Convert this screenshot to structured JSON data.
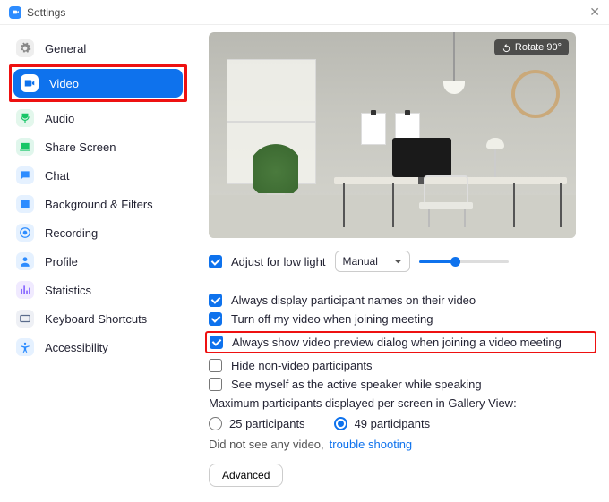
{
  "window": {
    "title": "Settings"
  },
  "sidebar": {
    "items": [
      {
        "label": "General",
        "icon": "gear",
        "bg": "#eeeeee",
        "fg": "#888888"
      },
      {
        "label": "Video",
        "icon": "video",
        "bg": "#ffffff",
        "fg": "#0E72ED",
        "active": true
      },
      {
        "label": "Audio",
        "icon": "audio",
        "bg": "#e3f7ec",
        "fg": "#17c667"
      },
      {
        "label": "Share Screen",
        "icon": "share",
        "bg": "#e0f6ec",
        "fg": "#17c667"
      },
      {
        "label": "Chat",
        "icon": "chat",
        "bg": "#e5f1ff",
        "fg": "#2D8CFF"
      },
      {
        "label": "Background & Filters",
        "icon": "bg",
        "bg": "#e5f1ff",
        "fg": "#2D8CFF"
      },
      {
        "label": "Recording",
        "icon": "rec",
        "bg": "#e5f1ff",
        "fg": "#2D8CFF"
      },
      {
        "label": "Profile",
        "icon": "profile",
        "bg": "#e5f1ff",
        "fg": "#2D8CFF"
      },
      {
        "label": "Statistics",
        "icon": "stats",
        "bg": "#f0eaff",
        "fg": "#8b6cff"
      },
      {
        "label": "Keyboard Shortcuts",
        "icon": "keyboard",
        "bg": "#eef0f5",
        "fg": "#5a6b8c"
      },
      {
        "label": "Accessibility",
        "icon": "a11y",
        "bg": "#e5f1ff",
        "fg": "#2D8CFF"
      }
    ]
  },
  "video": {
    "rotate_label": "Rotate 90°",
    "adjust_low_light": {
      "label": "Adjust for low light",
      "checked": true
    },
    "low_light_mode": {
      "selected": "Manual"
    },
    "options": [
      {
        "label": "Always display participant names on their video",
        "checked": true
      },
      {
        "label": "Turn off my video when joining meeting",
        "checked": true
      },
      {
        "label": "Always show video preview dialog when joining a video meeting",
        "checked": true,
        "highlighted": true
      },
      {
        "label": "Hide non-video participants",
        "checked": false
      },
      {
        "label": "See myself as the active speaker while speaking",
        "checked": false
      }
    ],
    "gallery": {
      "label": "Maximum participants displayed per screen in Gallery View:",
      "choices": [
        {
          "label": "25 participants",
          "checked": false
        },
        {
          "label": "49 participants",
          "checked": true
        }
      ]
    },
    "trouble": {
      "prefix": "Did not see any video,",
      "link": "trouble shooting"
    },
    "advanced_label": "Advanced"
  }
}
